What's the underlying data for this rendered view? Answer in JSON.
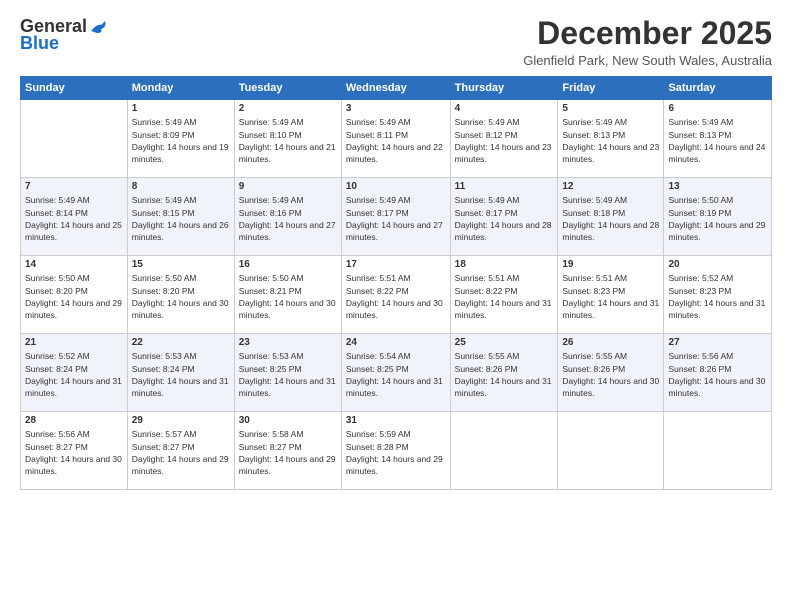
{
  "logo": {
    "general": "General",
    "blue": "Blue"
  },
  "header": {
    "month": "December 2025",
    "location": "Glenfield Park, New South Wales, Australia"
  },
  "days_of_week": [
    "Sunday",
    "Monday",
    "Tuesday",
    "Wednesday",
    "Thursday",
    "Friday",
    "Saturday"
  ],
  "weeks": [
    [
      {
        "day": "",
        "sunrise": "",
        "sunset": "",
        "daylight": ""
      },
      {
        "day": "1",
        "sunrise": "Sunrise: 5:49 AM",
        "sunset": "Sunset: 8:09 PM",
        "daylight": "Daylight: 14 hours and 19 minutes."
      },
      {
        "day": "2",
        "sunrise": "Sunrise: 5:49 AM",
        "sunset": "Sunset: 8:10 PM",
        "daylight": "Daylight: 14 hours and 21 minutes."
      },
      {
        "day": "3",
        "sunrise": "Sunrise: 5:49 AM",
        "sunset": "Sunset: 8:11 PM",
        "daylight": "Daylight: 14 hours and 22 minutes."
      },
      {
        "day": "4",
        "sunrise": "Sunrise: 5:49 AM",
        "sunset": "Sunset: 8:12 PM",
        "daylight": "Daylight: 14 hours and 23 minutes."
      },
      {
        "day": "5",
        "sunrise": "Sunrise: 5:49 AM",
        "sunset": "Sunset: 8:13 PM",
        "daylight": "Daylight: 14 hours and 23 minutes."
      },
      {
        "day": "6",
        "sunrise": "Sunrise: 5:49 AM",
        "sunset": "Sunset: 8:13 PM",
        "daylight": "Daylight: 14 hours and 24 minutes."
      }
    ],
    [
      {
        "day": "7",
        "sunrise": "Sunrise: 5:49 AM",
        "sunset": "Sunset: 8:14 PM",
        "daylight": "Daylight: 14 hours and 25 minutes."
      },
      {
        "day": "8",
        "sunrise": "Sunrise: 5:49 AM",
        "sunset": "Sunset: 8:15 PM",
        "daylight": "Daylight: 14 hours and 26 minutes."
      },
      {
        "day": "9",
        "sunrise": "Sunrise: 5:49 AM",
        "sunset": "Sunset: 8:16 PM",
        "daylight": "Daylight: 14 hours and 27 minutes."
      },
      {
        "day": "10",
        "sunrise": "Sunrise: 5:49 AM",
        "sunset": "Sunset: 8:17 PM",
        "daylight": "Daylight: 14 hours and 27 minutes."
      },
      {
        "day": "11",
        "sunrise": "Sunrise: 5:49 AM",
        "sunset": "Sunset: 8:17 PM",
        "daylight": "Daylight: 14 hours and 28 minutes."
      },
      {
        "day": "12",
        "sunrise": "Sunrise: 5:49 AM",
        "sunset": "Sunset: 8:18 PM",
        "daylight": "Daylight: 14 hours and 28 minutes."
      },
      {
        "day": "13",
        "sunrise": "Sunrise: 5:50 AM",
        "sunset": "Sunset: 8:19 PM",
        "daylight": "Daylight: 14 hours and 29 minutes."
      }
    ],
    [
      {
        "day": "14",
        "sunrise": "Sunrise: 5:50 AM",
        "sunset": "Sunset: 8:20 PM",
        "daylight": "Daylight: 14 hours and 29 minutes."
      },
      {
        "day": "15",
        "sunrise": "Sunrise: 5:50 AM",
        "sunset": "Sunset: 8:20 PM",
        "daylight": "Daylight: 14 hours and 30 minutes."
      },
      {
        "day": "16",
        "sunrise": "Sunrise: 5:50 AM",
        "sunset": "Sunset: 8:21 PM",
        "daylight": "Daylight: 14 hours and 30 minutes."
      },
      {
        "day": "17",
        "sunrise": "Sunrise: 5:51 AM",
        "sunset": "Sunset: 8:22 PM",
        "daylight": "Daylight: 14 hours and 30 minutes."
      },
      {
        "day": "18",
        "sunrise": "Sunrise: 5:51 AM",
        "sunset": "Sunset: 8:22 PM",
        "daylight": "Daylight: 14 hours and 31 minutes."
      },
      {
        "day": "19",
        "sunrise": "Sunrise: 5:51 AM",
        "sunset": "Sunset: 8:23 PM",
        "daylight": "Daylight: 14 hours and 31 minutes."
      },
      {
        "day": "20",
        "sunrise": "Sunrise: 5:52 AM",
        "sunset": "Sunset: 8:23 PM",
        "daylight": "Daylight: 14 hours and 31 minutes."
      }
    ],
    [
      {
        "day": "21",
        "sunrise": "Sunrise: 5:52 AM",
        "sunset": "Sunset: 8:24 PM",
        "daylight": "Daylight: 14 hours and 31 minutes."
      },
      {
        "day": "22",
        "sunrise": "Sunrise: 5:53 AM",
        "sunset": "Sunset: 8:24 PM",
        "daylight": "Daylight: 14 hours and 31 minutes."
      },
      {
        "day": "23",
        "sunrise": "Sunrise: 5:53 AM",
        "sunset": "Sunset: 8:25 PM",
        "daylight": "Daylight: 14 hours and 31 minutes."
      },
      {
        "day": "24",
        "sunrise": "Sunrise: 5:54 AM",
        "sunset": "Sunset: 8:25 PM",
        "daylight": "Daylight: 14 hours and 31 minutes."
      },
      {
        "day": "25",
        "sunrise": "Sunrise: 5:55 AM",
        "sunset": "Sunset: 8:26 PM",
        "daylight": "Daylight: 14 hours and 31 minutes."
      },
      {
        "day": "26",
        "sunrise": "Sunrise: 5:55 AM",
        "sunset": "Sunset: 8:26 PM",
        "daylight": "Daylight: 14 hours and 30 minutes."
      },
      {
        "day": "27",
        "sunrise": "Sunrise: 5:56 AM",
        "sunset": "Sunset: 8:26 PM",
        "daylight": "Daylight: 14 hours and 30 minutes."
      }
    ],
    [
      {
        "day": "28",
        "sunrise": "Sunrise: 5:56 AM",
        "sunset": "Sunset: 8:27 PM",
        "daylight": "Daylight: 14 hours and 30 minutes."
      },
      {
        "day": "29",
        "sunrise": "Sunrise: 5:57 AM",
        "sunset": "Sunset: 8:27 PM",
        "daylight": "Daylight: 14 hours and 29 minutes."
      },
      {
        "day": "30",
        "sunrise": "Sunrise: 5:58 AM",
        "sunset": "Sunset: 8:27 PM",
        "daylight": "Daylight: 14 hours and 29 minutes."
      },
      {
        "day": "31",
        "sunrise": "Sunrise: 5:59 AM",
        "sunset": "Sunset: 8:28 PM",
        "daylight": "Daylight: 14 hours and 29 minutes."
      },
      {
        "day": "",
        "sunrise": "",
        "sunset": "",
        "daylight": ""
      },
      {
        "day": "",
        "sunrise": "",
        "sunset": "",
        "daylight": ""
      },
      {
        "day": "",
        "sunrise": "",
        "sunset": "",
        "daylight": ""
      }
    ]
  ]
}
